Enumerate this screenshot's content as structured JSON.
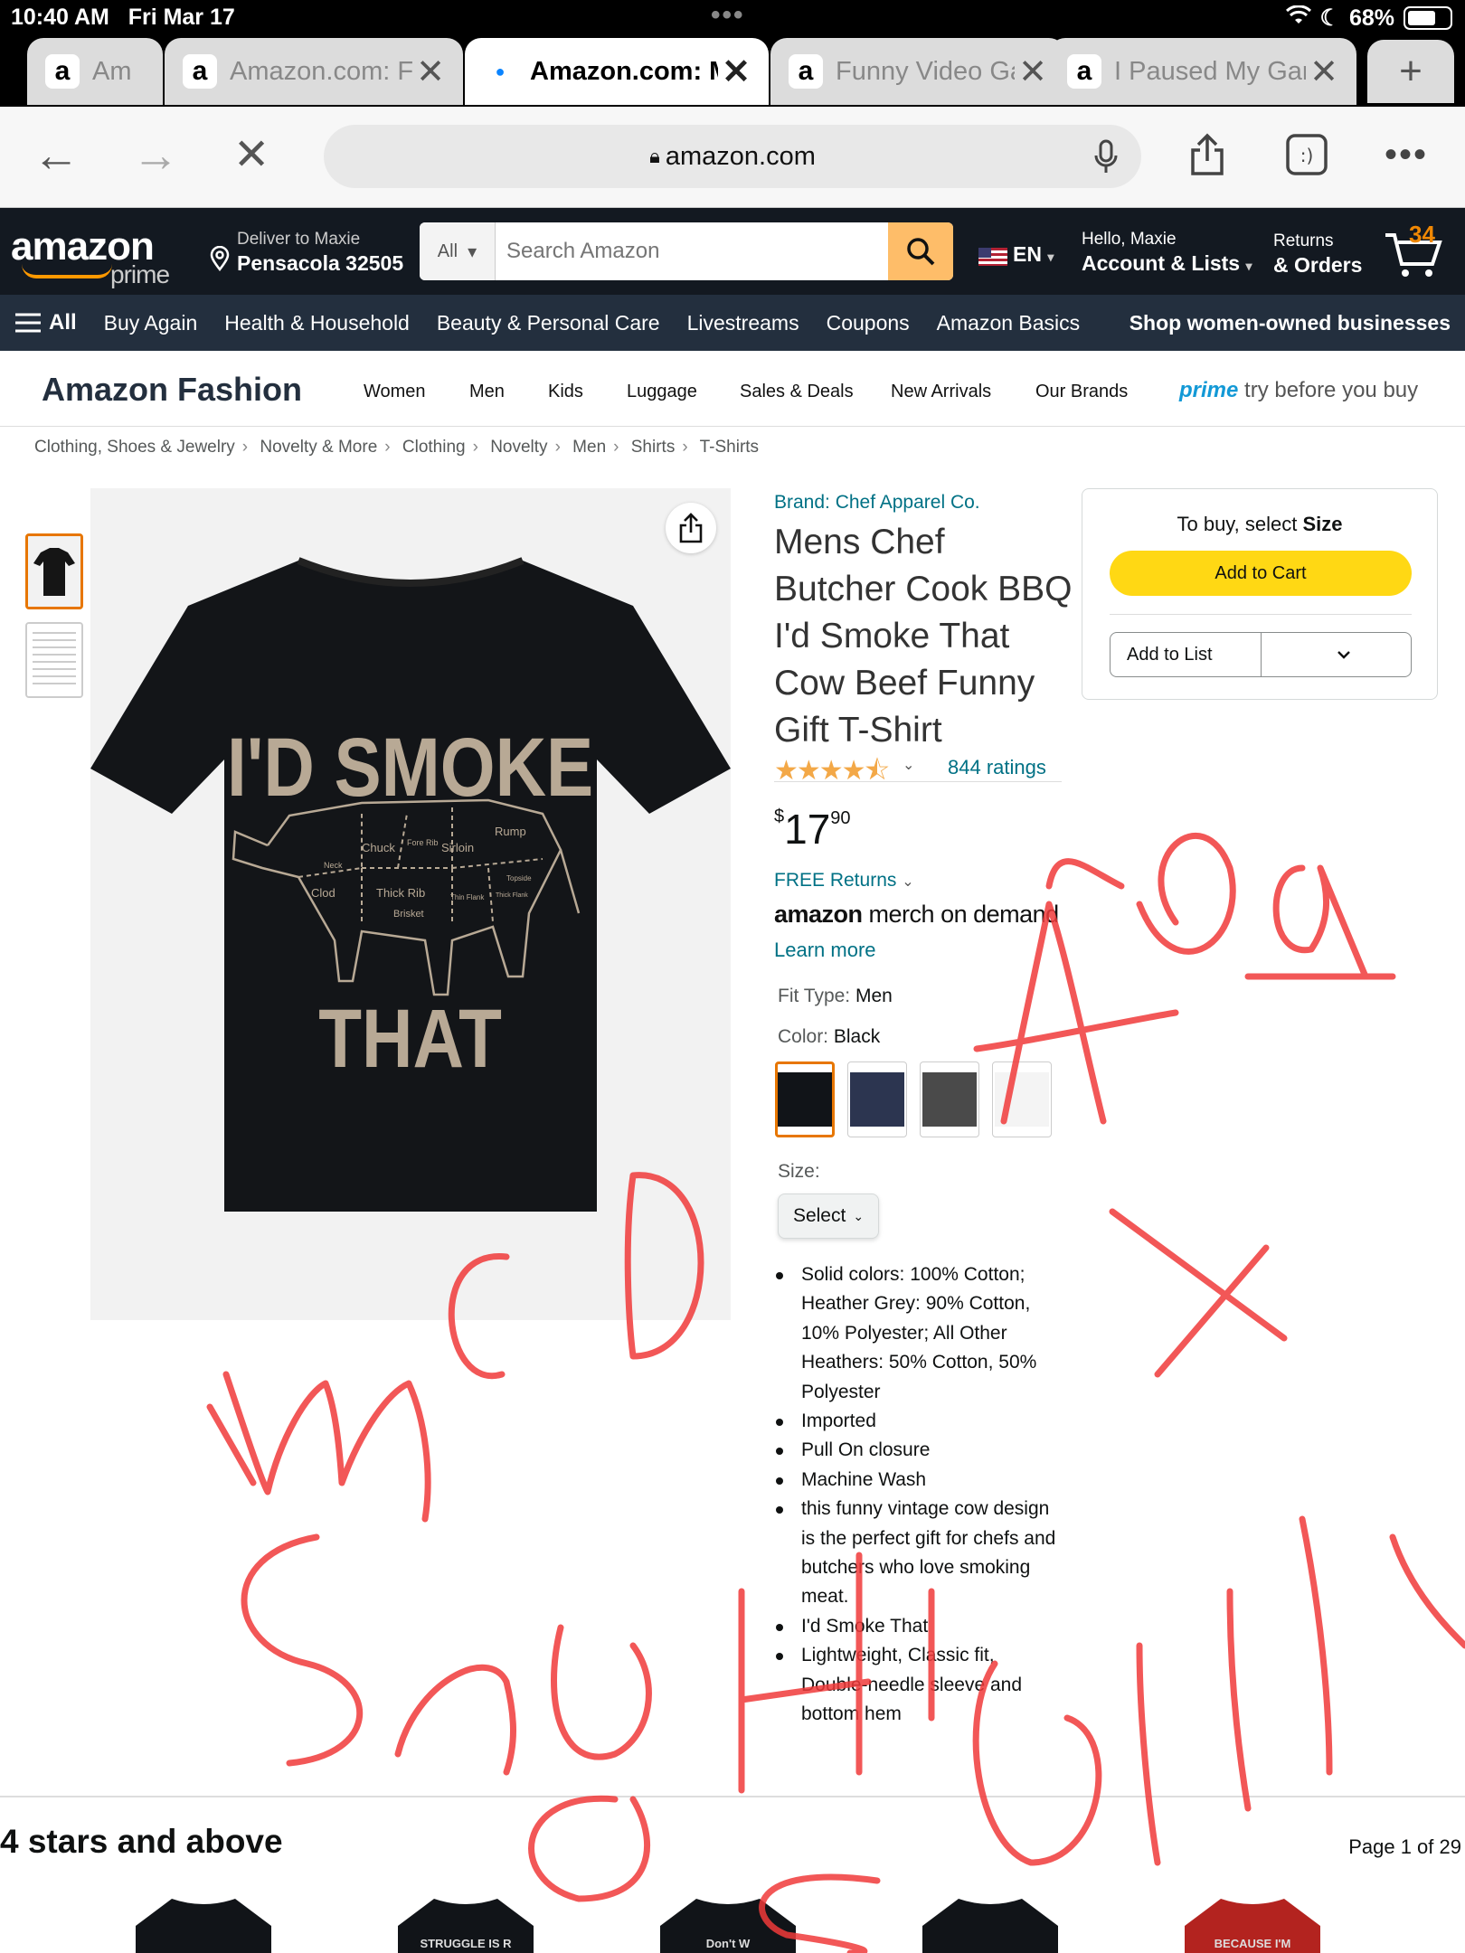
{
  "status_bar": {
    "time": "10:40 AM",
    "date": "Fri Mar 17",
    "battery": "68%"
  },
  "tabs": [
    {
      "favicon": "a",
      "title": "Am",
      "close": ""
    },
    {
      "favicon": "a",
      "title": "Amazon.com: Funny T",
      "close": "✕"
    },
    {
      "favicon": "",
      "title": "Amazon.com: Mens",
      "close": "✕",
      "active": true
    },
    {
      "favicon": "a",
      "title": "Funny Video Games",
      "close": "✕"
    },
    {
      "favicon": "a",
      "title": "I Paused My Game",
      "close": "✕"
    }
  ],
  "browser": {
    "url": "amazon.com"
  },
  "header": {
    "logo": "amazon",
    "logo_sub": "prime",
    "deliver_line1": "Deliver to Maxie",
    "deliver_line2": "Pensacola 32505",
    "search_scope": "All",
    "search_placeholder": "Search Amazon",
    "language": "EN",
    "account_line1": "Hello, Maxie",
    "account_line2": "Account & Lists",
    "returns_line1": "Returns",
    "returns_line2": "& Orders",
    "cart_count": "34"
  },
  "nav": {
    "all": "All",
    "items": [
      "Buy Again",
      "Health & Household",
      "Beauty & Personal Care",
      "Livestreams",
      "Coupons",
      "Amazon Basics"
    ],
    "promo": "Shop women-owned businesses"
  },
  "fashion": {
    "title": "Amazon Fashion",
    "links": [
      "Women",
      "Men",
      "Kids",
      "Luggage",
      "Sales & Deals",
      "New Arrivals",
      "Our Brands"
    ],
    "prime_word": "prime",
    "prime_rest": " try before you buy"
  },
  "breadcrumbs": [
    "Clothing, Shoes & Jewelry",
    "Novelty & More",
    "Clothing",
    "Novelty",
    "Men",
    "Shirts",
    "T-Shirts"
  ],
  "product": {
    "brand": "Brand: Chef Apparel Co.",
    "title": "Mens Chef Butcher Cook BBQ I'd Smoke That Cow Beef Funny Gift T-Shirt",
    "rating": 4.5,
    "rating_stars": "★★★★⯪",
    "ratings_count": "844 ratings",
    "price_symbol": "$",
    "price_whole": "17",
    "price_fraction": "90",
    "free_returns": "FREE Returns",
    "merch_brand": "amazon",
    "merch_text": "merch on demand",
    "learn_more": "Learn more",
    "fit_label": "Fit Type:",
    "fit_value": "Men",
    "color_label": "Color:",
    "color_value": "Black",
    "swatch_colors": [
      "#111418",
      "#2c3550",
      "#4a4a4a",
      "#f4f4f4"
    ],
    "size_label": "Size:",
    "size_select": "Select",
    "bullets": [
      "Solid colors: 100% Cotton; Heather Grey: 90% Cotton, 10% Polyester; All Other Heathers: 50% Cotton, 50% Polyester",
      "Imported",
      "Pull On closure",
      "Machine Wash",
      "this funny vintage cow design is the perfect gift for chefs and butchers who love smoking meat.",
      "I'd Smoke That",
      "Lightweight, Classic fit, Double-needle sleeve and bottom hem"
    ],
    "shirt_text_top": "I'D SMOKE",
    "shirt_text_bottom": "THAT",
    "shirt_cuts": [
      "Chuck",
      "Fore Rib",
      "Sirloin",
      "Rump",
      "Neck",
      "Clod",
      "Thick Rib",
      "Thin Flank",
      "Thick Flank",
      "Topside",
      "Brisket"
    ]
  },
  "buybox": {
    "prompt_pre": "To buy, select ",
    "prompt_bold": "Size",
    "add_to_cart": "Add to Cart",
    "add_to_list": "Add to List"
  },
  "recommendations": {
    "title": "4 stars and above",
    "page": "Page 1 of 29",
    "items": [
      {
        "color": "#111418",
        "text": ""
      },
      {
        "color": "#111418",
        "text": "STRUGGLE IS R"
      },
      {
        "color": "#111418",
        "text": "Don't W"
      },
      {
        "color": "#111418",
        "text": ""
      },
      {
        "color": "#b3231f",
        "text": "BECAUSE I'M"
      }
    ]
  },
  "annotation": {
    "color": "#f03a3a"
  }
}
